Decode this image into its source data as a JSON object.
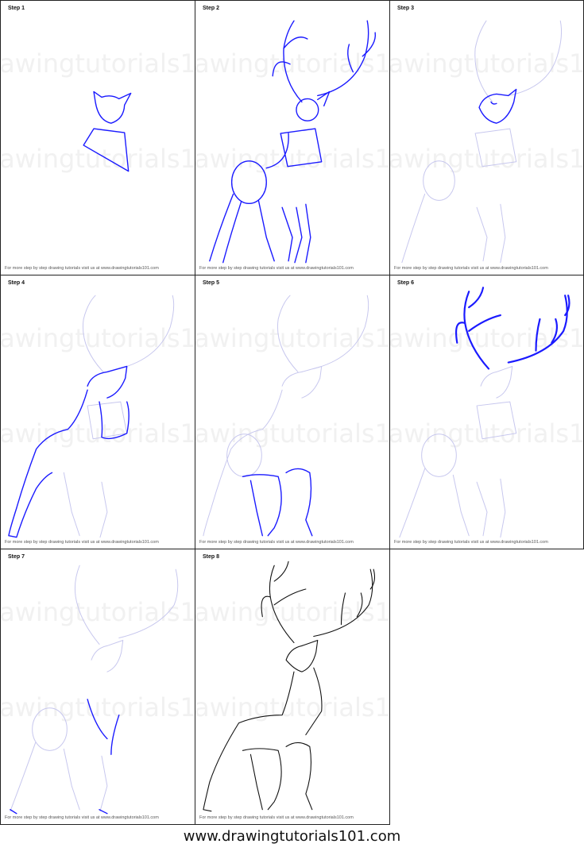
{
  "panels": [
    {
      "label": "Step 1",
      "footer": "For more step by step drawing tutorials visit us at www.drawingtutorials101.com"
    },
    {
      "label": "Step 2",
      "footer": "For more step by step drawing tutorials visit us at www.drawingtutorials101.com"
    },
    {
      "label": "Step 3",
      "footer": "For more step by step drawing tutorials visit us at www.drawingtutorials101.com"
    },
    {
      "label": "Step 4",
      "footer": "For more step by step drawing tutorials visit us at www.drawingtutorials101.com"
    },
    {
      "label": "Step 5",
      "footer": "For more step by step drawing tutorials visit us at www.drawingtutorials101.com"
    },
    {
      "label": "Step 6",
      "footer": "For more step by step drawing tutorials visit us at www.drawingtutorials101.com"
    },
    {
      "label": "Step 7",
      "footer": "For more step by step drawing tutorials visit us at www.drawingtutorials101.com"
    },
    {
      "label": "Step 8",
      "footer": "For more step by step drawing tutorials visit us at www.drawingtutorials101.com"
    }
  ],
  "watermark": "www.drawingtutorials101.com",
  "site_footer": "www.drawingtutorials101.com",
  "colors": {
    "guide_blue": "#1a1aff",
    "faint_guide": "#c7c7ee",
    "final_ink": "#111111"
  }
}
